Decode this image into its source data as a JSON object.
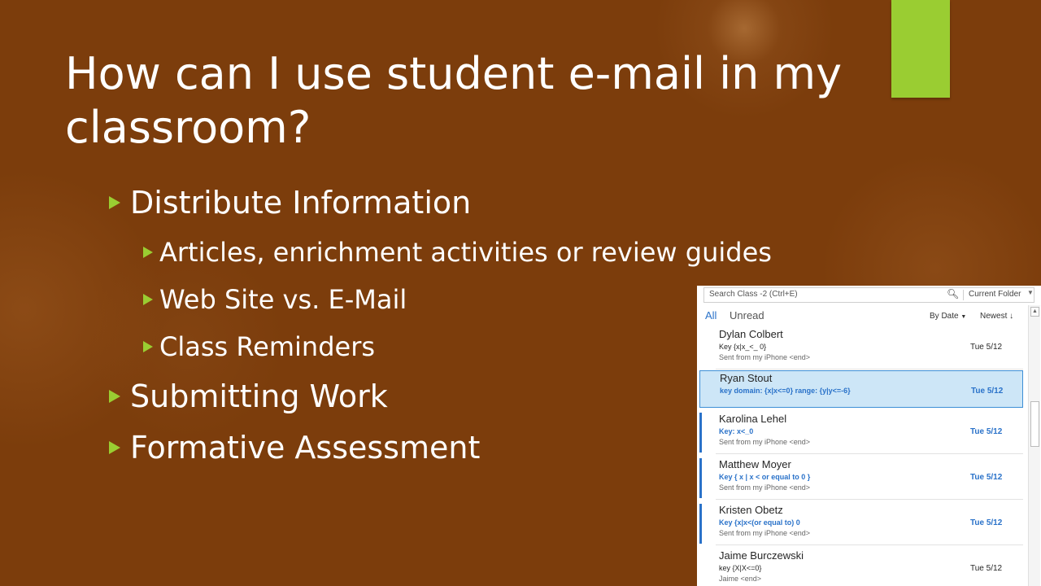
{
  "slide": {
    "title": "How can I use student e-mail in my classroom?",
    "bullets": [
      {
        "text": "Distribute Information",
        "level": 1
      },
      {
        "text": "Articles, enrichment activities or review guides",
        "level": 2
      },
      {
        "text": "Web Site vs. E-Mail",
        "level": 2
      },
      {
        "text": "Class Reminders",
        "level": 2
      },
      {
        "text": "Submitting Work",
        "level": 1
      },
      {
        "text": "Formative Assessment",
        "level": 1
      }
    ],
    "accent_color": "#9acd32",
    "background_color": "#7c3d0c"
  },
  "mail": {
    "search_placeholder": "Search Class -2 (Ctrl+E)",
    "search_scope": "Current Folder",
    "filter_all": "All",
    "filter_unread": "Unread",
    "sort_by": "By Date",
    "sort_order": "Newest",
    "messages": [
      {
        "sender": "Dylan Colbert",
        "subject": "Key {x|x_<_ 0}",
        "preview": "Sent from my iPhone <end>",
        "date": "Tue 5/12",
        "state": "read"
      },
      {
        "sender": "Ryan Stout",
        "subject": "key domain: {x|x<=0} range: {y|y<=-6}",
        "preview": "",
        "date": "Tue 5/12",
        "state": "selected"
      },
      {
        "sender": "Karolina Lehel",
        "subject": "Key: x<_0",
        "preview": "Sent from my iPhone <end>",
        "date": "Tue 5/12",
        "state": "unread"
      },
      {
        "sender": "Matthew Moyer",
        "subject": "Key { x | x < or equal to 0 }",
        "preview": "Sent from my iPhone <end>",
        "date": "Tue 5/12",
        "state": "unread"
      },
      {
        "sender": "Kristen Obetz",
        "subject": "Key {x|x<(or equal to) 0",
        "preview": "Sent from my iPhone <end>",
        "date": "Tue 5/12",
        "state": "unread"
      },
      {
        "sender": "Jaime Burczewski",
        "subject": "key {X|X<=0}",
        "preview": "Jaime <end>",
        "date": "Tue 5/12",
        "state": "read"
      }
    ]
  }
}
